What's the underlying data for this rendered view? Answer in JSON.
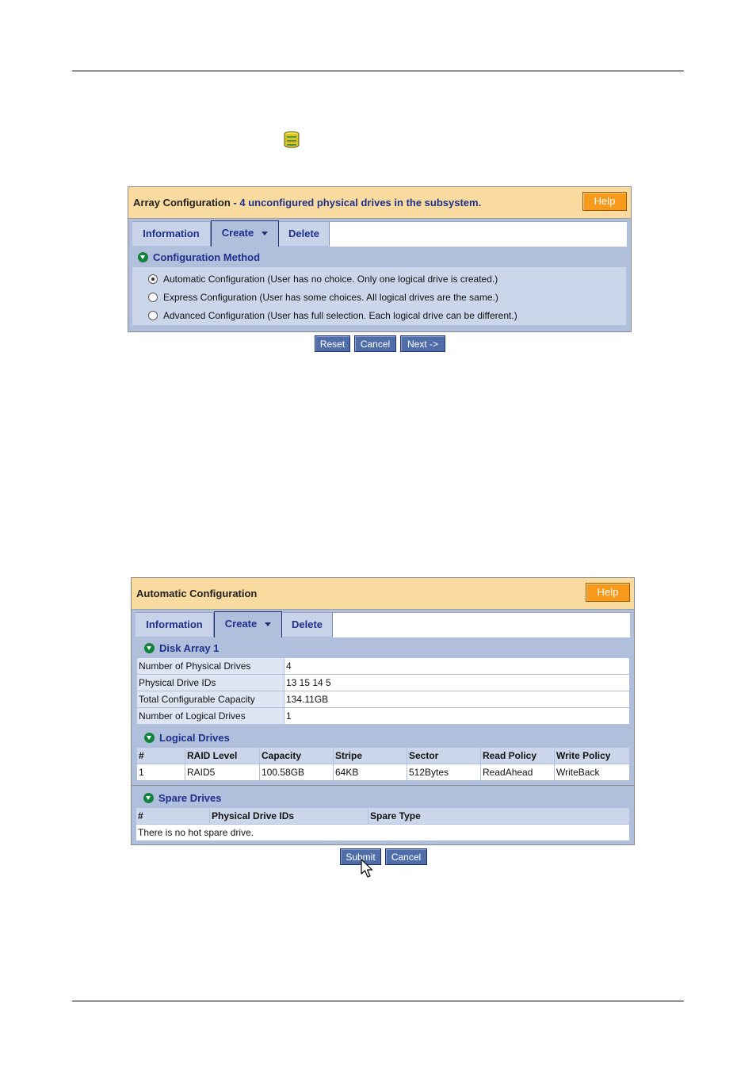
{
  "config_panel": {
    "title": "Array Configuration",
    "subtitle": " - 4 unconfigured physical drives in the subsystem.",
    "help": "Help",
    "tabs": {
      "information": "Information",
      "create": "Create",
      "delete": "Delete"
    },
    "section": "Configuration Method",
    "options": [
      {
        "label": "Automatic Configuration (User has no choice. Only one logical drive is created.)",
        "selected": true
      },
      {
        "label": "Express Configuration (User has some choices. All logical drives are the same.)",
        "selected": false
      },
      {
        "label": "Advanced Configuration (User has full selection. Each logical drive can be different.)",
        "selected": false
      }
    ],
    "buttons": {
      "reset": "Reset",
      "cancel": "Cancel",
      "next": "Next ->"
    }
  },
  "auto_panel": {
    "title": "Automatic Configuration",
    "help": "Help",
    "tabs": {
      "information": "Information",
      "create": "Create",
      "delete": "Delete"
    },
    "disk_array": {
      "heading": "Disk Array 1",
      "rows": [
        {
          "key": "Number of Physical Drives",
          "value": "4"
        },
        {
          "key": "Physical Drive IDs",
          "value": "13 15 14 5"
        },
        {
          "key": "Total Configurable Capacity",
          "value": "134.11GB"
        },
        {
          "key": "Number of Logical Drives",
          "value": "1"
        }
      ]
    },
    "logical_drives": {
      "heading": "Logical Drives",
      "columns": [
        "#",
        "RAID Level",
        "Capacity",
        "Stripe",
        "Sector",
        "Read Policy",
        "Write Policy"
      ],
      "rows": [
        [
          "1",
          "RAID5",
          "100.58GB",
          "64KB",
          "512Bytes",
          "ReadAhead",
          "WriteBack"
        ]
      ]
    },
    "spare_drives": {
      "heading": "Spare Drives",
      "columns": [
        "#",
        "Physical Drive IDs",
        "Spare Type"
      ],
      "empty": "There is no hot spare drive."
    },
    "buttons": {
      "submit": "Submit",
      "cancel": "Cancel"
    }
  },
  "colors": {
    "header_bg": "#f9dba0",
    "help_button": "#f79a1c",
    "panel_bg": "#b0bfdb",
    "button_blue": "#4f6ea9",
    "heading_blue": "#1e2f8c"
  }
}
